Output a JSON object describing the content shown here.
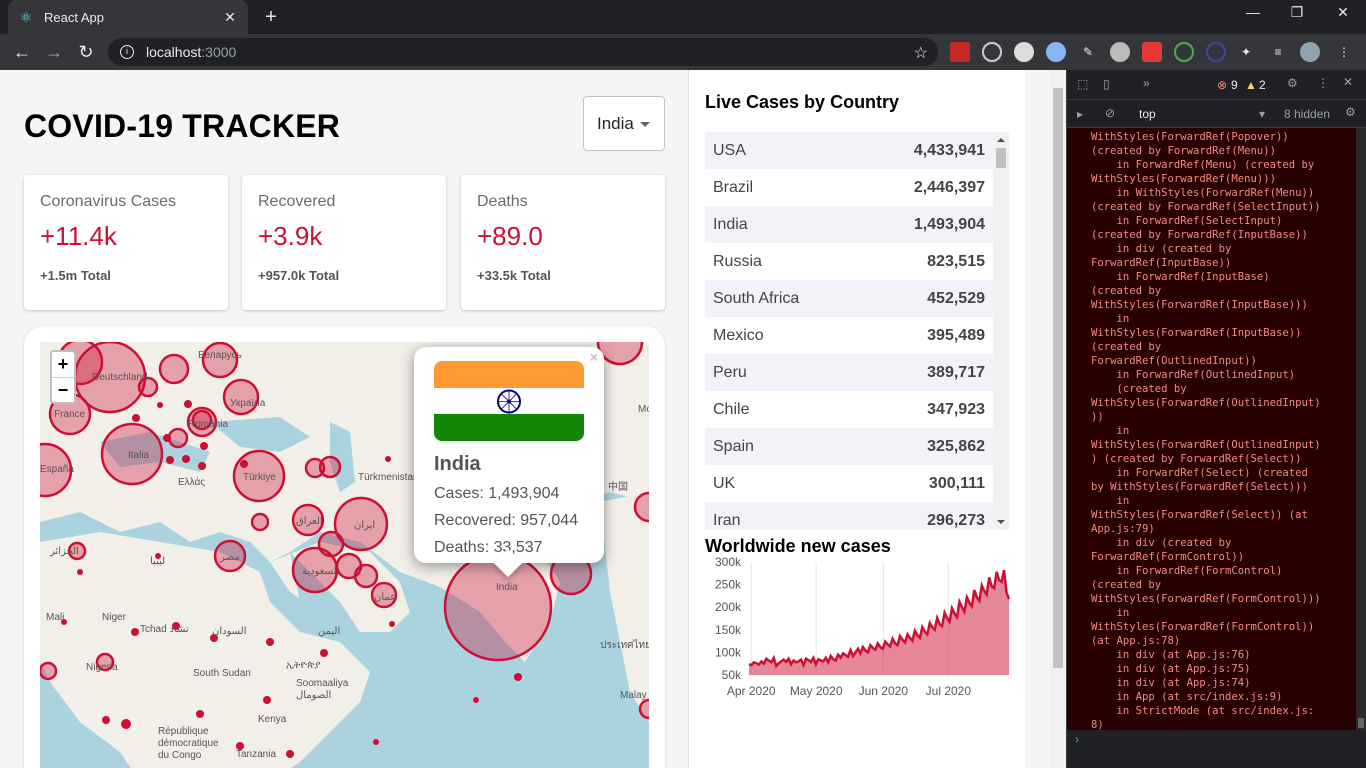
{
  "browser": {
    "tab_title": "React App",
    "url_host": "localhost",
    "url_port": ":3000",
    "favicon_color": "#61dafb"
  },
  "app": {
    "title": "COVID-19 TRACKER",
    "country_select": "India",
    "accent": "#cc1034"
  },
  "cards": [
    {
      "title": "Coronavirus Cases",
      "value": "+11.4k",
      "total": "+1.5m Total"
    },
    {
      "title": "Recovered",
      "value": "+3.9k",
      "total": "+957.0k Total"
    },
    {
      "title": "Deaths",
      "value": "+89.0",
      "total": "+33.5k Total"
    }
  ],
  "map": {
    "zoom_in": "+",
    "zoom_out": "−",
    "popup": {
      "close": "×",
      "country": "India",
      "cases": "Cases: 1,493,904",
      "recovered": "Recovered: 957,044",
      "deaths": "Deaths: 33,537"
    },
    "labels": {
      "deutschland": "Deutschland",
      "belarus": "Беларусь",
      "france": "France",
      "ukraina": "Україна",
      "romania": "România",
      "italia": "Italia",
      "espana": "España",
      "turkiye": "Türkiye",
      "ellas": "Ελλάς",
      "turkmenistan": "Türkmenistan",
      "china": "中国",
      "iraq": "العراق",
      "iran": "ایران",
      "algeria": "الجزائر",
      "libya": "ليبيا",
      "egypt": "مصر",
      "saudi": "السعودية",
      "oman": "عمان",
      "india": "India",
      "mali": "Mali",
      "niger": "Niger",
      "tchad": "Tchad تشاد",
      "sudan": "السودان",
      "yemen": "اليمن",
      "ethiopia": "ኢትዮጵያ",
      "nigeria": "Nigeria",
      "south_sudan": "South Sudan",
      "somalia": "Soomaaliya\nالصومال",
      "kenya": "Kenya",
      "drc": "République\ndémocratique\ndu Congo",
      "tanzania": "Tanzania",
      "thailand": "ประเทศไทย",
      "malay": "Malay",
      "mo": "Mo"
    }
  },
  "live_cases": {
    "title": "Live Cases by Country",
    "rows": [
      {
        "country": "USA",
        "cases": "4,433,941"
      },
      {
        "country": "Brazil",
        "cases": "2,446,397"
      },
      {
        "country": "India",
        "cases": "1,493,904"
      },
      {
        "country": "Russia",
        "cases": "823,515"
      },
      {
        "country": "South Africa",
        "cases": "452,529"
      },
      {
        "country": "Mexico",
        "cases": "395,489"
      },
      {
        "country": "Peru",
        "cases": "389,717"
      },
      {
        "country": "Chile",
        "cases": "347,923"
      },
      {
        "country": "Spain",
        "cases": "325,862"
      },
      {
        "country": "UK",
        "cases": "300,111"
      },
      {
        "country": "Iran",
        "cases": "296,273"
      }
    ]
  },
  "chart_data": {
    "type": "area",
    "title": "Worldwide new cases",
    "ylim": [
      50000,
      300000
    ],
    "y_ticks": [
      "300k",
      "250k",
      "200k",
      "150k",
      "100k",
      "50k"
    ],
    "x_ticks": [
      "Apr 2020",
      "May 2020",
      "Jun 2020",
      "Jul 2020"
    ],
    "color": "#cc1034",
    "fill": "rgba(204,16,52,0.5)",
    "x_start": "2020-03-31",
    "x_end": "2020-07-29",
    "series": [
      {
        "values": [
          74000,
          72000,
          78000,
          76000,
          73000,
          80000,
          75000,
          86000,
          82000,
          78000,
          88000,
          70000,
          76000,
          80000,
          84000,
          79000,
          86000,
          74000,
          82000,
          78000,
          80000,
          84000,
          72000,
          86000,
          83000,
          79000,
          88000,
          74000,
          85000,
          82000,
          80000,
          88000,
          78000,
          92000,
          85000,
          82000,
          95000,
          88000,
          98000,
          94000,
          90000,
          105000,
          92000,
          100000,
          108000,
          98000,
          112000,
          104000,
          100000,
          116000,
          110000,
          106000,
          120000,
          112000,
          108000,
          124000,
          118000,
          113000,
          130000,
          120000,
          116000,
          136000,
          128000,
          122000,
          140000,
          132000,
          126000,
          148000,
          138000,
          132000,
          156000,
          146000,
          140000,
          165000,
          156000,
          150000,
          176000,
          162000,
          158000,
          188000,
          176000,
          168000,
          198000,
          186000,
          178000,
          212000,
          200000,
          190000,
          222000,
          210000,
          202000,
          238000,
          222000,
          214000,
          248000,
          236000,
          228000,
          266000,
          246000,
          242000,
          278000,
          260000,
          256000,
          282000,
          232000,
          218000
        ]
      }
    ]
  },
  "devtools": {
    "errors": "9",
    "warnings": "2",
    "context": "top",
    "hidden": "8 hidden",
    "console_text": "WithStyles(ForwardRef(Popover))\n(created by ForwardRef(Menu))\n    in ForwardRef(Menu) (created by\nWithStyles(ForwardRef(Menu)))\n    in WithStyles(ForwardRef(Menu))\n(created by ForwardRef(SelectInput))\n    in ForwardRef(SelectInput)\n(created by ForwardRef(InputBase))\n    in div (created by\nForwardRef(InputBase))\n    in ForwardRef(InputBase)\n(created by\nWithStyles(ForwardRef(InputBase)))\n    in\nWithStyles(ForwardRef(InputBase))\n(created by\nForwardRef(OutlinedInput))\n    in ForwardRef(OutlinedInput)\n    (created by\nWithStyles(ForwardRef(OutlinedInput)\n))\n    in\nWithStyles(ForwardRef(OutlinedInput)\n) (created by ForwardRef(Select))\n    in ForwardRef(Select) (created\nby WithStyles(ForwardRef(Select)))\n    in\nWithStyles(ForwardRef(Select)) (at\nApp.js:79)\n    in div (created by\nForwardRef(FormControl))\n    in ForwardRef(FormControl)\n(created by\nWithStyles(ForwardRef(FormControl)))\n    in\nWithStyles(ForwardRef(FormControl))\n(at App.js:78)\n    in div (at App.js:76)\n    in div (at App.js:75)\n    in div (at App.js:74)\n    in App (at src/index.js:9)\n    in StrictMode (at src/index.js:\n8)"
  }
}
